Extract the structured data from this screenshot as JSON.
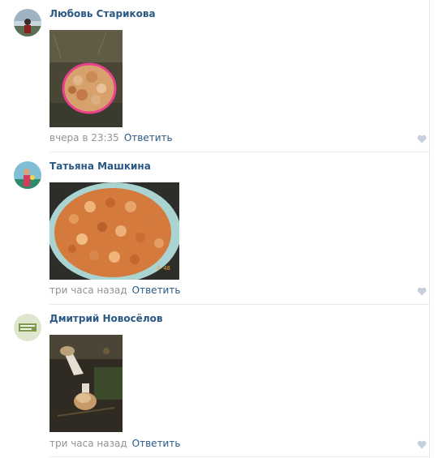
{
  "comments": [
    {
      "author": "Любовь Старикова",
      "time": "вчера в 23:35",
      "reply_label": "Ответить",
      "avatar": "person-by-water-avatar",
      "photo": "pink-basin-mushrooms-photo"
    },
    {
      "author": "Татьяна Машкина",
      "time": "три часа назад",
      "reply_label": "Ответить",
      "avatar": "person-with-flowers-avatar",
      "photo": "mushrooms-in-bowl-photo",
      "photo_stamp": "8 48"
    },
    {
      "author": "Дмитрий Новосёлов",
      "time": "три часа назад",
      "reply_label": "Ответить",
      "avatar": "green-badge-avatar",
      "photo": "boletus-in-forest-photo"
    }
  ],
  "colors": {
    "link": "#2a5885",
    "meta": "#939393",
    "divider": "#e7e8ec",
    "heart": "#c5d0db"
  }
}
